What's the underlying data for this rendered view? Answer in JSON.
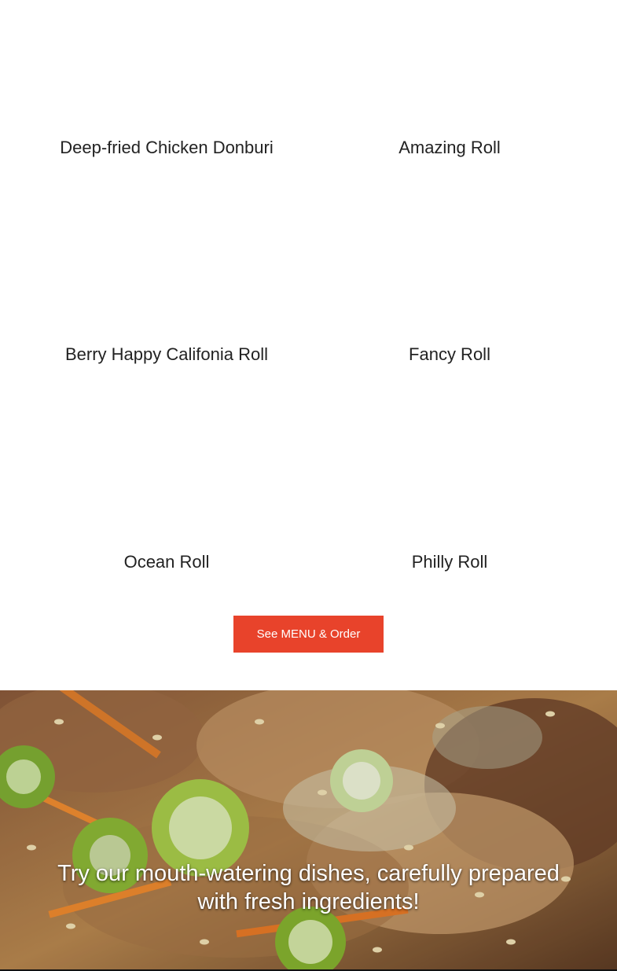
{
  "menu": {
    "items": [
      {
        "name": "Deep-fried Chicken Donburi"
      },
      {
        "name": "Amazing Roll"
      },
      {
        "name": "Berry Happy Califonia Roll"
      },
      {
        "name": "Fancy Roll"
      },
      {
        "name": "Ocean Roll"
      },
      {
        "name": "Philly Roll"
      }
    ],
    "cta_label": "See MENU & Order"
  },
  "hero": {
    "text_line1": "Try our mouth-watering dishes, carefully prepared",
    "text_line2": "with fresh ingredients!"
  },
  "colors": {
    "accent": "#e8432b",
    "text": "#222222"
  }
}
